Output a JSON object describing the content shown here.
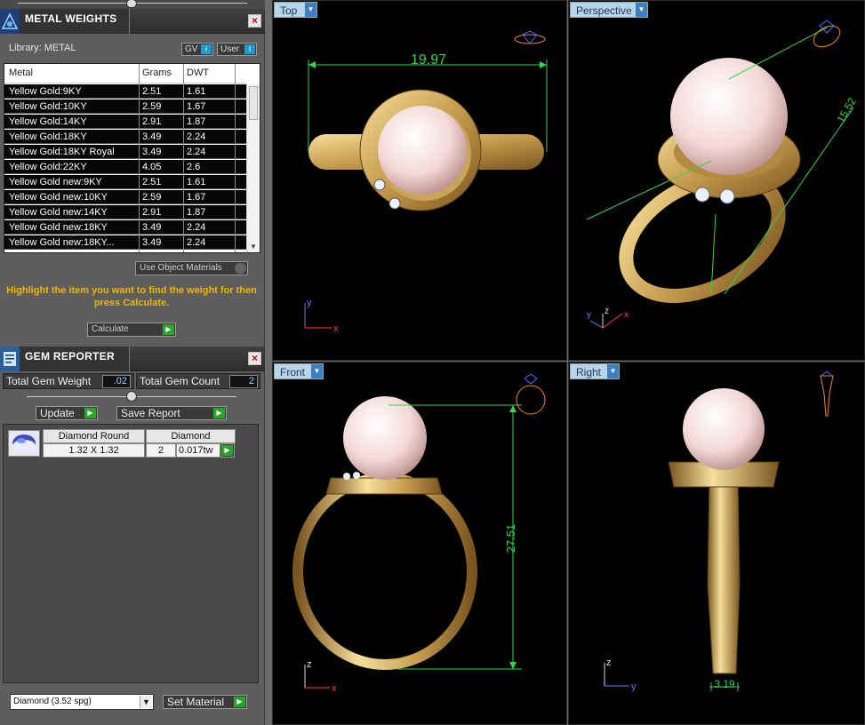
{
  "metal_panel": {
    "title": "METAL WEIGHTS",
    "library_label": "Library: METAL",
    "gv_label": "GV",
    "user_label": "User",
    "columns": [
      "Metal",
      "Grams",
      "DWT"
    ],
    "rows": [
      [
        "Yellow Gold:9KY",
        "2.51",
        "1.61"
      ],
      [
        "Yellow Gold:10KY",
        "2.59",
        "1.67"
      ],
      [
        "Yellow Gold:14KY",
        "2.91",
        "1.87"
      ],
      [
        "Yellow Gold:18KY",
        "3.49",
        "2.24"
      ],
      [
        "Yellow Gold:18KY Royal",
        "3.49",
        "2.24"
      ],
      [
        "Yellow Gold:22KY",
        "4.05",
        "2.6"
      ],
      [
        "Yellow Gold new:9KY",
        "2.51",
        "1.61"
      ],
      [
        "Yellow Gold new:10KY",
        "2.59",
        "1.67"
      ],
      [
        "Yellow Gold new:14KY",
        "2.91",
        "1.87"
      ],
      [
        "Yellow Gold new:18KY",
        "3.49",
        "2.24"
      ],
      [
        "Yellow Gold new:18KY...",
        "3.49",
        "2.24"
      ]
    ],
    "use_object_materials": "Use Object Materials",
    "hint": "Highlight the item you want to find the weight for then press Calculate.",
    "calculate": "Calculate"
  },
  "gem_panel": {
    "title": "GEM REPORTER",
    "total_weight_label": "Total Gem Weight",
    "total_weight_value": ".02",
    "total_count_label": "Total Gem Count",
    "total_count_value": "2",
    "update": "Update",
    "save_report": "Save Report",
    "gem_type": "Diamond Round",
    "gem_material": "Diamond",
    "gem_size": "1.32 X 1.32",
    "gem_count": "2",
    "gem_weight": "0.017tw",
    "material_select": "Diamond      (3.52 spg)",
    "set_material": "Set Material"
  },
  "viewports": {
    "top": {
      "label": "Top",
      "dimension": "19.97",
      "axis_v": "y",
      "axis_h": "x"
    },
    "perspective": {
      "label": "Perspective",
      "dimension": "15.52",
      "axis_a": "y",
      "axis_b": "z",
      "axis_c": "x"
    },
    "front": {
      "label": "Front",
      "dimension": "27.51",
      "axis_v": "z",
      "axis_h": "x"
    },
    "right": {
      "label": "Right",
      "dimension": "3.19",
      "axis_v": "z",
      "axis_h": "y"
    }
  }
}
